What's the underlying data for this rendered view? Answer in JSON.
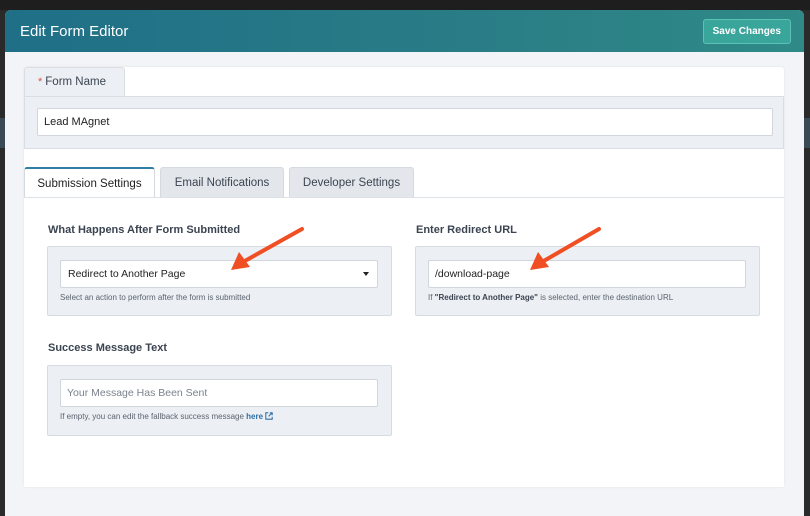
{
  "modal": {
    "title": "Edit Form Editor",
    "save_label": "Save Changes"
  },
  "form_name": {
    "label": "Form Name",
    "required_mark": "*",
    "value": "Lead MAgnet"
  },
  "tabs": [
    {
      "label": "Submission Settings",
      "active": true
    },
    {
      "label": "Email Notifications",
      "active": false
    },
    {
      "label": "Developer Settings",
      "active": false
    }
  ],
  "after_submit": {
    "label": "What Happens After Form Submitted",
    "selected": "Redirect to Another Page",
    "help": "Select an action to perform after the form is submitted"
  },
  "redirect": {
    "label": "Enter Redirect URL",
    "value": "/download-page",
    "help_prefix": "If ",
    "help_bold": "\"Redirect to Another Page\"",
    "help_suffix": " is selected, enter the destination URL"
  },
  "success": {
    "label": "Success Message Text",
    "placeholder": "Your Message Has Been Sent",
    "help_prefix": "If empty, you can edit the fallback success message ",
    "help_link": "here"
  },
  "colors": {
    "header": "#1f6f87",
    "save_button": "#3aa59b",
    "active_tab_border": "#2f7fa7",
    "annotation_arrow": "#f04e23"
  },
  "icons": {
    "dropdown": "caret-down-icon",
    "external_link": "external-link-icon",
    "annotation": "red-arrow-icon"
  }
}
